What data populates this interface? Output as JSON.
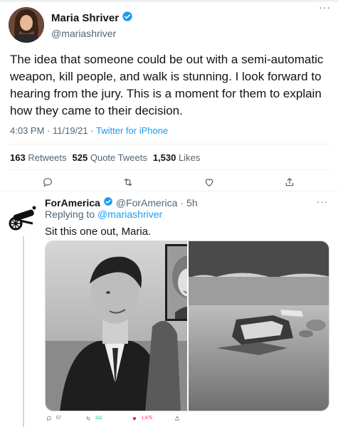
{
  "tweet": {
    "author": {
      "name": "Maria Shriver",
      "handle": "@mariashriver"
    },
    "more_label": "···",
    "text": "The idea that someone could be out with a semi-automatic weapon, kill people, and walk is stunning. I look forward to hearing from the jury. This is a moment for them to explain how they came to their decision.",
    "time": "4:03 PM",
    "date": "11/19/21",
    "separator": "·",
    "source": "Twitter for iPhone",
    "stats": {
      "retweets_count": "163",
      "retweets_label": "Retweets",
      "quotes_count": "525",
      "quotes_label": "Quote Tweets",
      "likes_count": "1,530",
      "likes_label": "Likes"
    },
    "actions": [
      "reply-icon",
      "retweet-icon",
      "like-icon",
      "share-icon"
    ]
  },
  "reply": {
    "author": {
      "name": "ForAmerica",
      "handle": "@ForAmerica",
      "time_ago": "5h"
    },
    "more_label": "···",
    "replying_to_prefix": "Replying to",
    "replying_to_handle": "@mariashriver",
    "text": "Sit this one out, Maria.",
    "counts": {
      "replies": "57",
      "retweets": "311",
      "likes": "1,975"
    }
  },
  "colors": {
    "accent": "#1d9bf0",
    "text_primary": "#0f1419",
    "text_secondary": "#536471",
    "retweet_green": "#00ba7c",
    "like_pink": "#f91880"
  }
}
